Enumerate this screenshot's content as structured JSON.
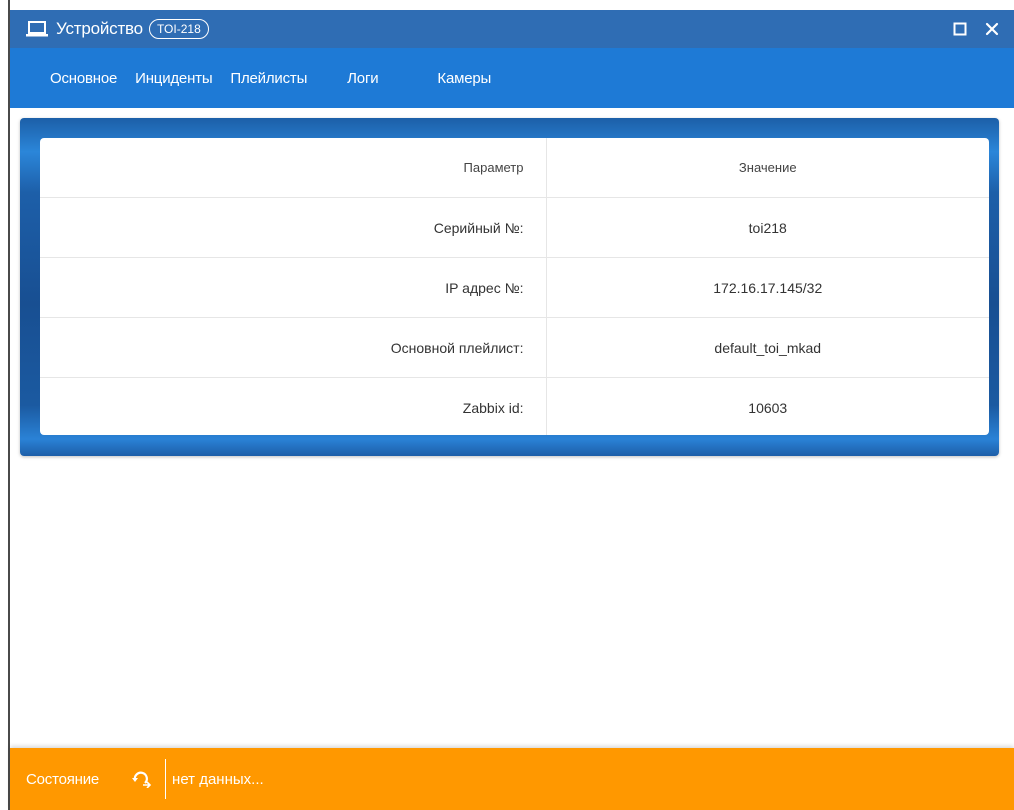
{
  "window": {
    "title": "Устройство",
    "badge": "TOI-218",
    "icons": {
      "title": "laptop-icon",
      "maximize": "maximize-icon",
      "close": "close-icon"
    },
    "colors": {
      "titlebar": "#2f6db4",
      "tabsbar": "#1e7ad6",
      "statusbar": "#ff9800"
    }
  },
  "tabs": [
    {
      "label": "Основное"
    },
    {
      "label": "Инциденты"
    },
    {
      "label": "Плейлисты"
    },
    {
      "label": "Логи"
    },
    {
      "label": "Камеры"
    }
  ],
  "table": {
    "header": {
      "param": "Параметр",
      "value": "Значение"
    },
    "rows": [
      {
        "param": "Серийный №:",
        "value": "toi218"
      },
      {
        "param": "IP адрес №:",
        "value": "172.16.17.145/32"
      },
      {
        "param": "Основной плейлист:",
        "value": "default_toi_mkad"
      },
      {
        "param": "Zabbix id:",
        "value": "10603"
      }
    ]
  },
  "status": {
    "label": "Состояние",
    "refresh_icon": "refresh-icon",
    "text": "нет данных..."
  }
}
